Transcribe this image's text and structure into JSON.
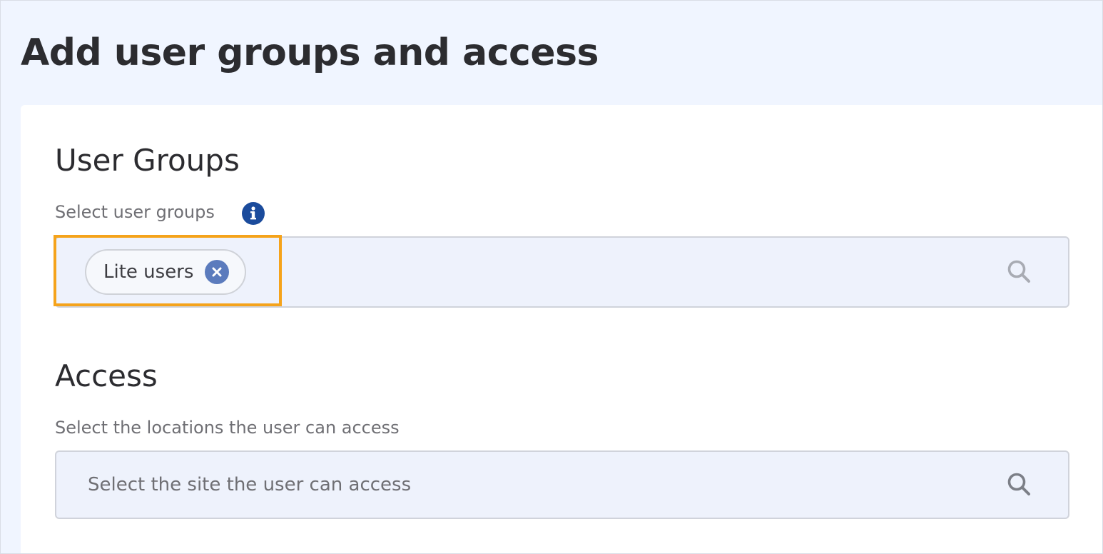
{
  "page": {
    "title": "Add user groups and access"
  },
  "user_groups": {
    "heading": "User Groups",
    "label": "Select user groups",
    "info_icon": "info-circle-icon",
    "selected_chips": [
      {
        "label": "Lite users",
        "remove_icon": "close-circle-icon"
      }
    ],
    "search_icon": "search-icon",
    "highlight_color": "#f5a31b"
  },
  "access": {
    "heading": "Access",
    "label": "Select the locations the user can access",
    "placeholder": "Select the site the user can access",
    "search_icon": "search-icon"
  },
  "colors": {
    "page_background": "#f0f5ff",
    "card_background": "#ffffff",
    "field_background": "#eef2fc",
    "info_icon": "#1b4b9c",
    "chip_remove": "#5b7bbd",
    "heading_text": "#2c2c30",
    "label_text": "#6f6f74"
  }
}
